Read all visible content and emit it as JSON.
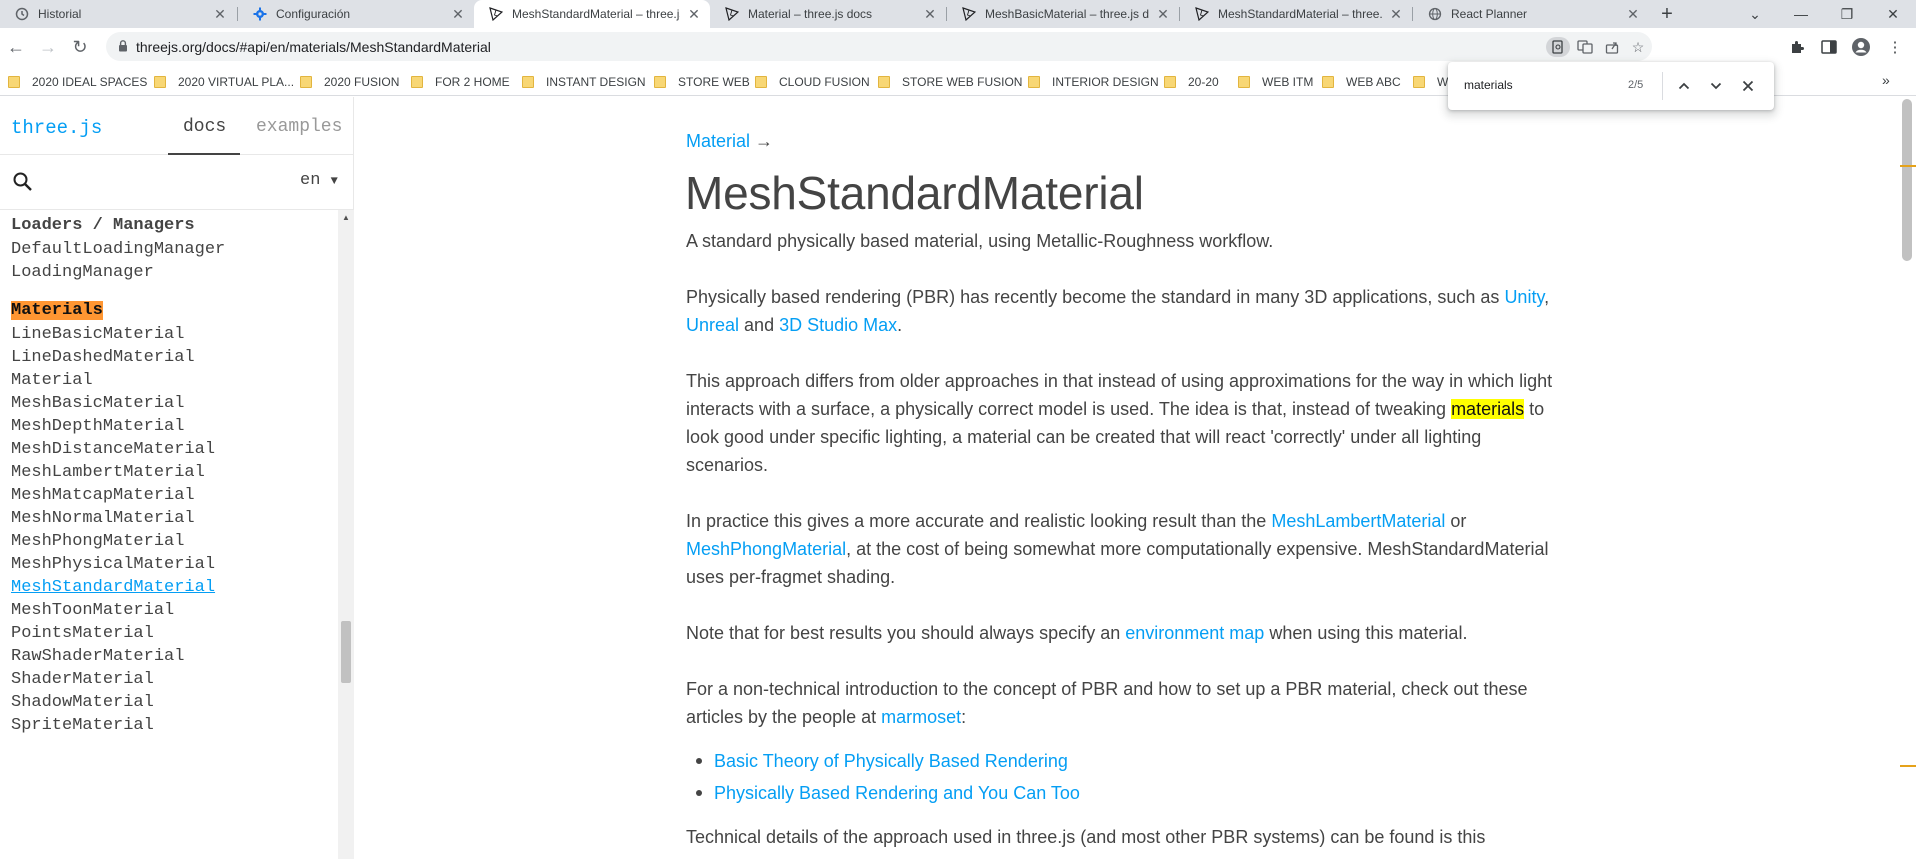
{
  "tabs": [
    {
      "title": "Historial",
      "icon": "history-icon"
    },
    {
      "title": "Configuración",
      "icon": "settings-gear-icon"
    },
    {
      "title": "MeshStandardMaterial – three.js",
      "icon": "threejs-icon"
    },
    {
      "title": "Material – three.js docs",
      "icon": "threejs-icon"
    },
    {
      "title": "MeshBasicMaterial – three.js docs",
      "icon": "threejs-icon"
    },
    {
      "title": "MeshStandardMaterial – three.js",
      "icon": "threejs-icon"
    },
    {
      "title": "React Planner",
      "icon": "globe-icon"
    }
  ],
  "address_bar": {
    "url": "threejs.org/docs/#api/en/materials/MeshStandardMaterial"
  },
  "bookmarks": [
    "2020 IDEAL SPACES",
    "2020 VIRTUAL PLA...",
    "2020 FUSION",
    "FOR 2 HOME",
    "INSTANT DESIGN",
    "STORE WEB",
    "CLOUD FUSION",
    "STORE WEB FUSION",
    "INTERIOR DESIGN",
    "20-20",
    "WEB ITM",
    "WEB ABC",
    "W"
  ],
  "find_bar": {
    "query": "materials",
    "count": "2/5"
  },
  "sidebar": {
    "brand": "three.js",
    "tab_docs": "docs",
    "tab_examples": "examples",
    "language": "en",
    "section_loaders": "Loaders / Managers",
    "loaders_items": [
      "DefaultLoadingManager",
      "LoadingManager"
    ],
    "section_materials": "Materials",
    "materials_items": [
      "LineBasicMaterial",
      "LineDashedMaterial",
      "Material",
      "MeshBasicMaterial",
      "MeshDepthMaterial",
      "MeshDistanceMaterial",
      "MeshLambertMaterial",
      "MeshMatcapMaterial",
      "MeshNormalMaterial",
      "MeshPhongMaterial",
      "MeshPhysicalMaterial",
      "MeshStandardMaterial",
      "MeshToonMaterial",
      "PointsMaterial",
      "RawShaderMaterial",
      "ShaderMaterial",
      "ShadowMaterial",
      "SpriteMaterial"
    ],
    "selected_item": "MeshStandardMaterial"
  },
  "content": {
    "breadcrumb_link": "Material",
    "breadcrumb_arrow": "→",
    "title": "MeshStandardMaterial",
    "p1": "A standard physically based material, using Metallic-Roughness workflow.",
    "p2_text": "Physically based rendering (PBR) has recently become the standard in many 3D applications, such as",
    "p2_link1": "Unity",
    "p2_sep1": ",",
    "p2_link2": "Unreal",
    "p2_and": "and",
    "p2_link3": "3D Studio Max",
    "p2_end": ".",
    "p3_a": "This approach differs from older approaches in that instead of using approximations for the way in which light interacts with a surface, a physically correct model is used. The idea is that, instead of tweaking",
    "p3_highlight": "materials",
    "p3_b": "to look good under specific lighting, a material can be created that will react 'correctly' under all lighting scenarios.",
    "p4_a": "In practice this gives a more accurate and realistic looking result than the",
    "p4_link1": "MeshLambertMaterial",
    "p4_or": "or",
    "p4_link2": "MeshPhongMaterial",
    "p4_b": ", at the cost of being somewhat more computationally expensive. MeshStandardMaterial uses per-fragmet shading.",
    "p5_a": "Note that for best results you should always specify an",
    "p5_link": "environment map",
    "p5_b": "when using this material.",
    "p6_a": "For a non-technical introduction to the concept of PBR and how to set up a PBR material, check out these articles by the people at",
    "p6_link": "marmoset",
    "p6_end": ":",
    "bullet1": "Basic Theory of Physically Based Rendering",
    "bullet2": "Physically Based Rendering and You Can Too",
    "p7": "Technical details of the approach used in three.js (and most other PBR systems) can be found is this"
  },
  "colors": {
    "link": "#049ef4",
    "find_current_match": "#ff9632",
    "find_match": "#ffff00",
    "text": "#444444"
  }
}
